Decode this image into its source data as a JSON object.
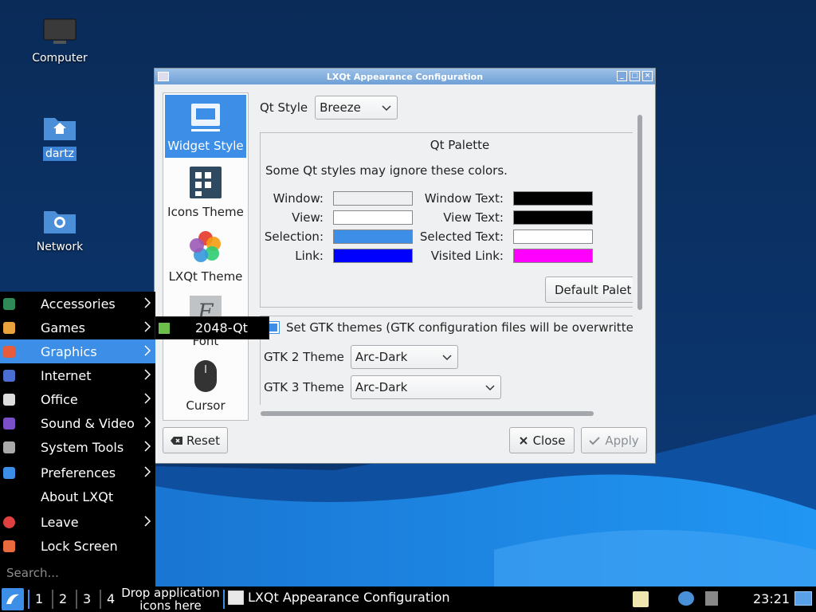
{
  "desktop": {
    "icons": [
      {
        "label": "Computer",
        "icon": "computer-monitor-icon"
      },
      {
        "label": "dartz",
        "icon": "home-folder-icon"
      },
      {
        "label": "Network",
        "icon": "network-folder-icon"
      }
    ]
  },
  "window": {
    "title": "LXQt Appearance Configuration",
    "categories": [
      {
        "label": "Widget Style",
        "icon": "widget-style-icon",
        "active": true
      },
      {
        "label": "Icons Theme",
        "icon": "icons-theme-icon"
      },
      {
        "label": "LXQt Theme",
        "icon": "lxqt-theme-icon"
      },
      {
        "label": "Font",
        "icon": "font-icon"
      },
      {
        "label": "Cursor",
        "icon": "cursor-mouse-icon"
      }
    ],
    "qt_style": {
      "label": "Qt Style",
      "value": "Breeze"
    },
    "palette": {
      "title": "Qt Palette",
      "note": "Some Qt styles may ignore these colors.",
      "window_label": "Window:",
      "view_label": "View:",
      "selection_label": "Selection:",
      "link_label": "Link:",
      "window_text_label": "Window Text:",
      "view_text_label": "View Text:",
      "selected_text_label": "Selected Text:",
      "visited_link_label": "Visited Link:",
      "colors": {
        "window": "#eff0f1",
        "view": "#ffffff",
        "selection": "#3d8ee6",
        "link": "#0000ff",
        "window_text": "#000000",
        "view_text": "#000000",
        "selected_text": "#ffffff",
        "visited_link": "#ff00ff"
      },
      "default_button": "Default Palet"
    },
    "gtk": {
      "checkbox_label": "Set GTK themes (GTK configuration files will be overwritte",
      "checked": true,
      "gtk2_label": "GTK 2 Theme",
      "gtk2_value": "Arc-Dark",
      "gtk3_label": "GTK 3 Theme",
      "gtk3_value": "Arc-Dark"
    },
    "buttons": {
      "reset": "Reset",
      "close": "Close",
      "apply": "Apply"
    }
  },
  "start_menu": {
    "items": [
      {
        "label": "Accessories",
        "icon": "accessories-icon",
        "color": "#2e8b57",
        "submenu": true
      },
      {
        "label": "Games",
        "icon": "games-icon",
        "color": "#e8a33d",
        "submenu": true
      },
      {
        "label": "Graphics",
        "icon": "graphics-icon",
        "color": "#e65c3d",
        "submenu": true,
        "active": true
      },
      {
        "label": "Internet",
        "icon": "internet-icon",
        "color": "#4a6fd0",
        "submenu": true
      },
      {
        "label": "Office",
        "icon": "office-icon",
        "color": "#dddddd",
        "submenu": true
      },
      {
        "label": "Sound & Video",
        "icon": "sound-video-icon",
        "color": "#7b4fc7",
        "submenu": true
      },
      {
        "label": "System Tools",
        "icon": "system-tools-icon",
        "color": "#aaaaaa",
        "submenu": true
      },
      {
        "label": "Preferences",
        "icon": "preferences-icon",
        "color": "#3d8ee6",
        "submenu": true
      },
      {
        "label": "About LXQt",
        "icon": "about-icon",
        "color": "#000000",
        "submenu": false
      },
      {
        "label": "Leave",
        "icon": "leave-icon",
        "color": "#e04040",
        "submenu": true
      },
      {
        "label": "Lock Screen",
        "icon": "lock-icon",
        "color": "#e86a3d",
        "submenu": false
      }
    ],
    "search_placeholder": "Search...",
    "submenu_item": "2048-Qt"
  },
  "taskbar": {
    "desktops": [
      "1",
      "2",
      "3",
      "4"
    ],
    "drop_text_line1": "Drop application",
    "drop_text_line2": "icons here",
    "task_title": "LXQt Appearance Configuration",
    "clock": "23:21"
  }
}
